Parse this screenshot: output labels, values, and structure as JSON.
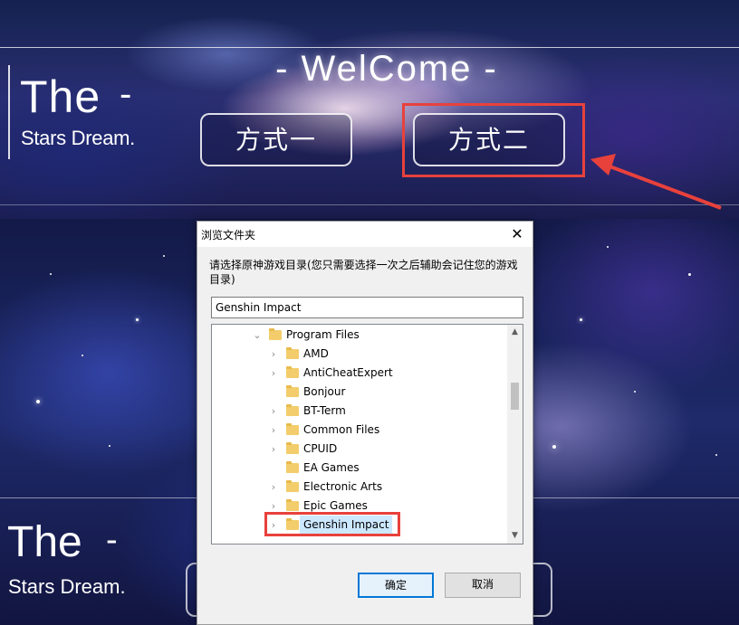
{
  "launcher_top": {
    "brand_the": "The",
    "brand_dash": "-",
    "brand_subtitle": "Stars Dream.",
    "welcome": "-  WelCome -",
    "mode_one_label": "方式一",
    "mode_two_label": "方式二",
    "highlight_color": "#e8413c"
  },
  "launcher_bottom": {
    "brand_the": "The",
    "brand_dash": "-",
    "brand_subtitle": "Stars Dream."
  },
  "dialog": {
    "title": "浏览文件夹",
    "close_label": "✕",
    "description": "请选择原神游戏目录(您只需要选择一次之后辅助会记住您的游戏目录)",
    "folder_input_value": "Genshin Impact",
    "tree": {
      "parent": {
        "label": "Program Files",
        "expanded": true
      },
      "items": [
        {
          "label": "AMD",
          "has_children": true
        },
        {
          "label": "AntiCheatExpert",
          "has_children": true
        },
        {
          "label": "Bonjour",
          "has_children": false
        },
        {
          "label": "BT-Term",
          "has_children": true
        },
        {
          "label": "Common Files",
          "has_children": true
        },
        {
          "label": "CPUID",
          "has_children": true
        },
        {
          "label": "EA Games",
          "has_children": false
        },
        {
          "label": "Electronic Arts",
          "has_children": true
        },
        {
          "label": "Epic Games",
          "has_children": true
        },
        {
          "label": "Genshin Impact",
          "has_children": true,
          "selected": true
        }
      ]
    },
    "ok_label": "确定",
    "cancel_label": "取消"
  }
}
